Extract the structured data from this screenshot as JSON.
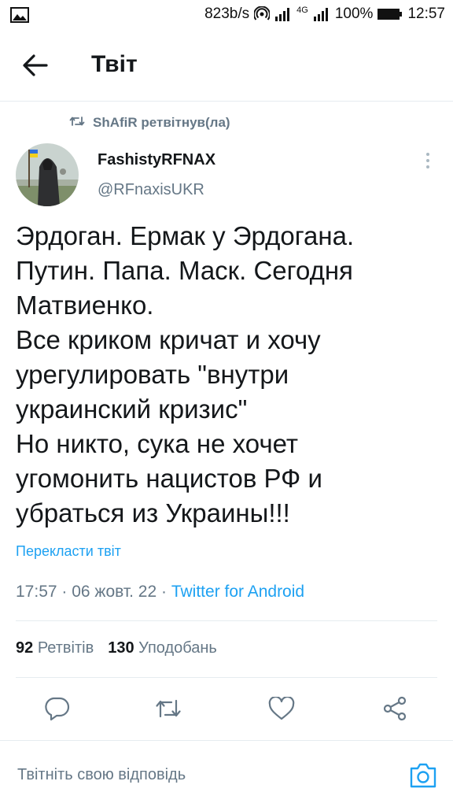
{
  "status_bar": {
    "speed": "823b/s",
    "network_type": "4G",
    "battery": "100%",
    "time": "12:57"
  },
  "header": {
    "title": "Твіт"
  },
  "retweet_notice": {
    "text": "ShAfiR ретвітнув(ла)"
  },
  "author": {
    "name": "FashistyRFNAX",
    "handle": "@RFnaxisUKR"
  },
  "tweet": {
    "text": "Эрдоган. Ермак у Эрдогана.\nПутин. Папа. Маск. Сегодня\nМатвиенко.\nВсе криком кричат и хочу\nурегулировать \"внутри\nукраинский кризис\"\nНо никто, сука не хочет\nугомонить нацистов РФ и\nубраться из Украины!!!",
    "translate_label": "Перекласти твіт",
    "time": "17:57",
    "separator": " · ",
    "date": "06 жовт. 22",
    "source": "Twitter for Android"
  },
  "stats": {
    "retweets_count": "92",
    "retweets_label": "Ретвітів",
    "likes_count": "130",
    "likes_label": "Уподобань"
  },
  "actions": {
    "icons": [
      "reply-icon",
      "retweet-icon",
      "like-icon",
      "share-icon"
    ]
  },
  "reply_bar": {
    "placeholder": "Твітніть свою відповідь"
  },
  "colors": {
    "accent": "#1da1f2",
    "secondary_text": "#657786",
    "divider": "#e6ecf0"
  }
}
